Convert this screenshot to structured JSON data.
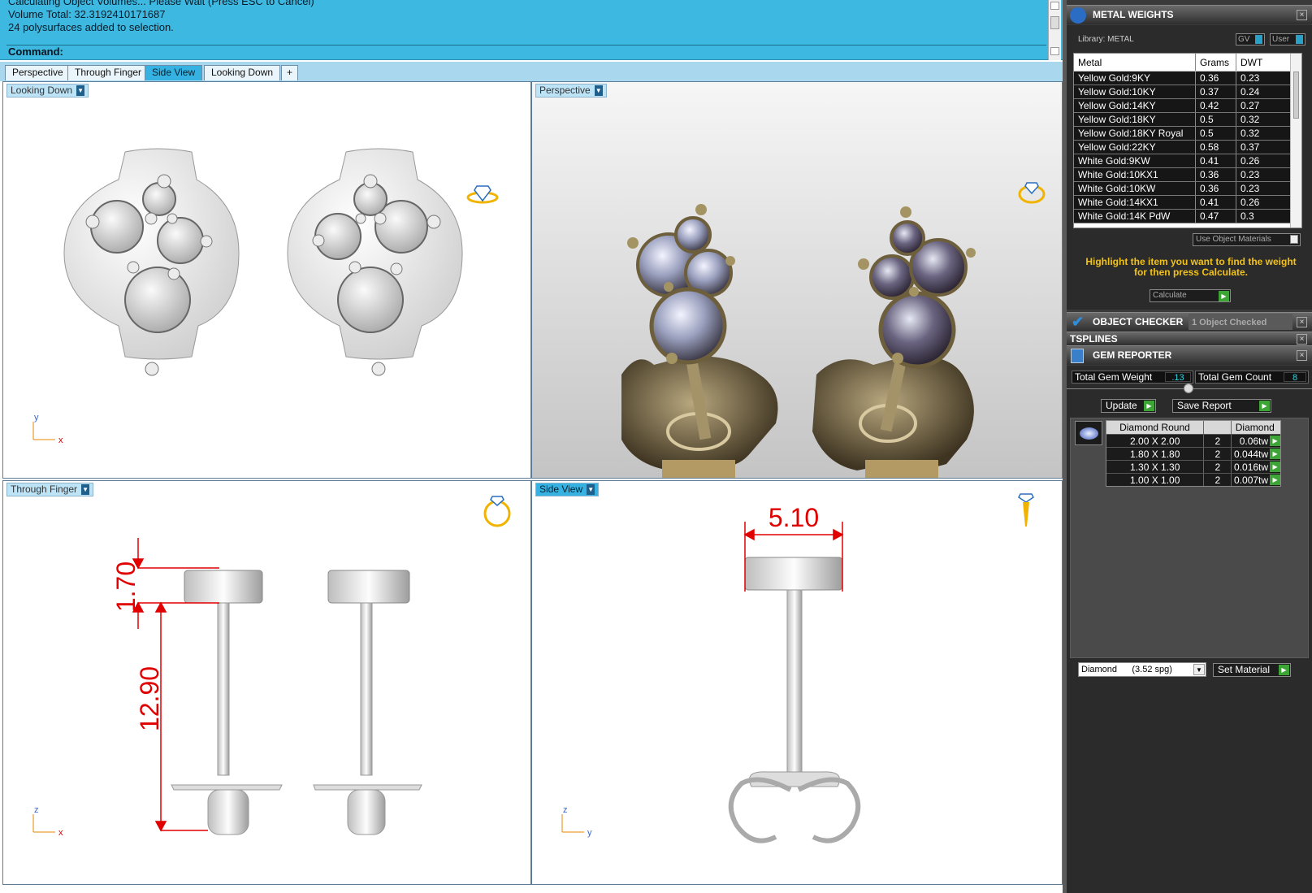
{
  "command": {
    "history": [
      "Calculating Object Volumes... Please Wait (Press ESC to Cancel)",
      "Volume Total: 32.3192410171687",
      "24 polysurfaces added to selection."
    ],
    "prompt": "Command:"
  },
  "tabs": [
    {
      "label": "Perspective",
      "active": false
    },
    {
      "label": "Through Finger",
      "active": false
    },
    {
      "label": "Side View",
      "active": true
    },
    {
      "label": "Looking Down",
      "active": false
    }
  ],
  "tab_add": "+",
  "viewports": {
    "top_left": {
      "label": "Looking Down",
      "axis_a": "y",
      "axis_b": "x"
    },
    "top_right": {
      "label": "Perspective"
    },
    "bottom_left": {
      "label": "Through Finger",
      "axis_a": "z",
      "axis_b": "x",
      "dim_small": "1.70",
      "dim_large": "12.90"
    },
    "bottom_right": {
      "label": "Side View",
      "axis_a": "z",
      "axis_b": "y",
      "dim_width": "5.10"
    }
  },
  "metal_weights": {
    "title": "METAL WEIGHTS",
    "library": "Library: METAL",
    "gv": "GV",
    "user": "User",
    "columns": [
      "Metal",
      "Grams",
      "DWT"
    ],
    "rows": [
      {
        "metal": "Yellow Gold:9KY",
        "grams": "0.36",
        "dwt": "0.23"
      },
      {
        "metal": "Yellow Gold:10KY",
        "grams": "0.37",
        "dwt": "0.24"
      },
      {
        "metal": "Yellow Gold:14KY",
        "grams": "0.42",
        "dwt": "0.27"
      },
      {
        "metal": "Yellow Gold:18KY",
        "grams": "0.5",
        "dwt": "0.32"
      },
      {
        "metal": "Yellow Gold:18KY Royal",
        "grams": "0.5",
        "dwt": "0.32"
      },
      {
        "metal": "Yellow Gold:22KY",
        "grams": "0.58",
        "dwt": "0.37"
      },
      {
        "metal": "White Gold:9KW",
        "grams": "0.41",
        "dwt": "0.26"
      },
      {
        "metal": "White Gold:10KX1",
        "grams": "0.36",
        "dwt": "0.23"
      },
      {
        "metal": "White Gold:10KW",
        "grams": "0.36",
        "dwt": "0.23"
      },
      {
        "metal": "White Gold:14KX1",
        "grams": "0.41",
        "dwt": "0.26"
      },
      {
        "metal": "White Gold:14K PdW",
        "grams": "0.47",
        "dwt": "0.3"
      }
    ],
    "use_object_materials": "Use Object Materials",
    "hint": "Highlight the item you want to find the weight for then press Calculate.",
    "calculate": "Calculate"
  },
  "object_checker": {
    "title": "OBJECT CHECKER",
    "status": "1 Object Checked"
  },
  "tsplines": {
    "title": "TSPLINES"
  },
  "gem_reporter": {
    "title": "GEM REPORTER",
    "total_weight_label": "Total Gem Weight",
    "total_weight": ".13",
    "total_count_label": "Total Gem Count",
    "total_count": "8",
    "update": "Update",
    "save_report": "Save Report",
    "col_shape": "Diamond Round",
    "col_material": "Diamond",
    "gems": [
      {
        "size": "2.00 X 2.00",
        "count": "2",
        "weight": "0.06tw"
      },
      {
        "size": "1.80 X 1.80",
        "count": "2",
        "weight": "0.044tw"
      },
      {
        "size": "1.30 X 1.30",
        "count": "2",
        "weight": "0.016tw"
      },
      {
        "size": "1.00 X 1.00",
        "count": "2",
        "weight": "0.007tw"
      }
    ],
    "material_select": "Diamond      (3.52 spg)",
    "set_material": "Set Material"
  },
  "colors": {
    "accent": "#35b2e2",
    "command_bg": "#3db8e0",
    "panel_bg": "#3a3a3a",
    "dim_red": "#e00000",
    "metal_gold": "#8a7a55",
    "yellow_hint": "#f2c21a",
    "green_button": "#3da436"
  },
  "icons": [
    "ring-icon",
    "diamond-icon",
    "gem-oval-icon",
    "checkmark-icon",
    "wand-icon",
    "report-icon",
    "close-icon",
    "chevron-down-icon",
    "plus-icon"
  ]
}
